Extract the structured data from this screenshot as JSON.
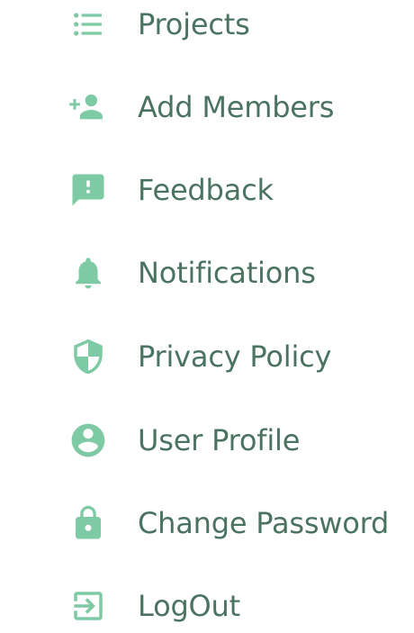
{
  "colors": {
    "icon": "#7dcaa5",
    "text": "#4a7361",
    "background": "#ffffff"
  },
  "menu": {
    "items": [
      {
        "label": "Projects",
        "icon": "list-icon"
      },
      {
        "label": "Add Members",
        "icon": "person-add-icon"
      },
      {
        "label": "Feedback",
        "icon": "feedback-icon"
      },
      {
        "label": "Notifications",
        "icon": "bell-icon"
      },
      {
        "label": "Privacy Policy",
        "icon": "shield-icon"
      },
      {
        "label": "User Profile",
        "icon": "account-circle-icon"
      },
      {
        "label": "Change Password",
        "icon": "lock-icon"
      },
      {
        "label": "LogOut",
        "icon": "logout-icon"
      }
    ]
  }
}
